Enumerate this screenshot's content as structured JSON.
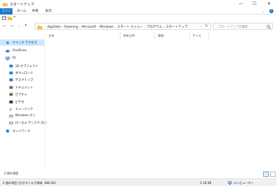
{
  "window": {
    "title": "スタートアップ",
    "controls": {
      "minimize": "—",
      "maximize": "☐",
      "close": "✕"
    }
  },
  "ribbon": {
    "tabs": [
      {
        "label": "ファイル",
        "active": true
      },
      {
        "label": "ホーム"
      },
      {
        "label": "共有"
      },
      {
        "label": "表示"
      }
    ],
    "help": "?"
  },
  "address_bar": {
    "breadcrumbs": [
      "AppData",
      "Roaming",
      "Microsoft",
      "Windows",
      "スタート メニュー",
      "プログラム",
      "スタートアップ"
    ],
    "separator": "›",
    "search_placeholder": "スタートアップの検索"
  },
  "nav_pane": {
    "items": [
      {
        "label": "クイック アクセス",
        "icon": "star-icon",
        "color": "#2b7cd3"
      },
      {
        "label": "OneDrive",
        "icon": "cloud-icon",
        "color": "#2b7cd3"
      },
      {
        "label": "PC",
        "icon": "computer-icon",
        "color": "#2b7cd3"
      },
      {
        "label": "3D オブジェクト",
        "icon": "cube-icon",
        "color": "#2b7cd3"
      },
      {
        "label": "ダウンロード",
        "icon": "download-icon",
        "color": "#2b7cd3"
      },
      {
        "label": "デスクトップ",
        "icon": "desktop-icon",
        "color": "#2b7cd3"
      },
      {
        "label": "ドキュメント",
        "icon": "document-icon",
        "color": "#6b6b6b"
      },
      {
        "label": "ピクチャ",
        "icon": "picture-icon",
        "color": "#6b6b6b"
      },
      {
        "label": "ビデオ",
        "icon": "video-icon",
        "color": "#333333"
      },
      {
        "label": "ミュージック",
        "icon": "music-icon",
        "color": "#2b7cd3"
      },
      {
        "label": "Windows (C:)",
        "icon": "drive-icon",
        "color": "#6b6b6b"
      },
      {
        "label": "ローカル ディスク (D:)",
        "icon": "drive-icon",
        "color": "#6b6b6b"
      },
      {
        "label": "ネットワーク",
        "icon": "network-icon",
        "color": "#2b7cd3"
      }
    ]
  },
  "columns": [
    "名前",
    "更新日時",
    "種類",
    "サイズ"
  ],
  "footer": {
    "item_count": "2 個の項目"
  },
  "status_bar": {
    "left": "2 個の項目 (空きディスク領域: 388 GB)",
    "size": "2.18 KB",
    "location": "コンピューター"
  },
  "colors": {
    "accent": "#1979ca",
    "folder": "#f0c14b"
  }
}
